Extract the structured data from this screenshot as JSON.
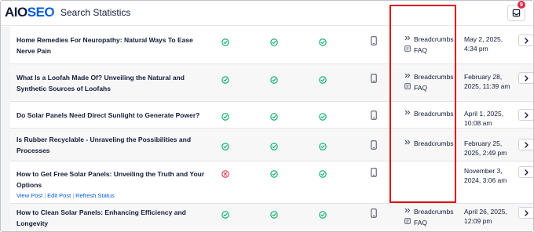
{
  "header": {
    "logo_part1": "AIO",
    "logo_part2": "SEO",
    "separator": "/",
    "title": "Search Statistics",
    "notification_count": "9"
  },
  "colors": {
    "brand_blue": "#005ae0",
    "success_green": "#00aa63",
    "error_red": "#df2a4a",
    "highlight_red": "#e00000",
    "text_dark": "#141b38"
  },
  "rows": [
    {
      "title_lines": [
        "Home Remedies For Neuropathy: Natural Ways To Ease",
        "Nerve Pain"
      ],
      "statuses": [
        "check",
        "check",
        "check"
      ],
      "rich_results": [
        "Breadcrumbs",
        "FAQ"
      ],
      "date_lines": [
        "May 2, 2025,",
        "4:34 pm"
      ]
    },
    {
      "title_lines": [
        "What Is a Loofah Made Of? Unveiling the Natural and",
        "Synthetic Sources of Loofahs"
      ],
      "statuses": [
        "check",
        "check",
        "check"
      ],
      "rich_results": [
        "Breadcrumbs",
        "FAQ"
      ],
      "date_lines": [
        "February 28,",
        "2025, 11:39 am"
      ]
    },
    {
      "title_lines": [
        "Do Solar Panels Need Direct Sunlight to Generate Power?"
      ],
      "statuses": [
        "check",
        "check",
        "check"
      ],
      "rich_results": [
        "Breadcrumbs"
      ],
      "date_lines": [
        "April 1, 2025,",
        "10:08 am"
      ]
    },
    {
      "title_lines": [
        "Is Rubber Recyclable - Unraveling the Possibilities and",
        "Processes"
      ],
      "statuses": [
        "check",
        "check",
        "check"
      ],
      "rich_results": [
        "Breadcrumbs"
      ],
      "date_lines": [
        "February 25,",
        "2025, 2:49 pm"
      ]
    },
    {
      "title_lines": [
        "How to Get Free Solar Panels: Unveiling the Truth and Your",
        "Options"
      ],
      "actions": [
        "View Post",
        "Edit Post",
        "Refresh Status"
      ],
      "action_separator": "|",
      "statuses": [
        "error",
        "check",
        "check"
      ],
      "rich_results": [],
      "date_lines": [
        "November 3,",
        "2024, 3:06 am"
      ]
    },
    {
      "title_lines": [
        "How to Clean Solar Panels: Enhancing Efficiency and",
        "Longevity"
      ],
      "statuses": [
        "check",
        "check",
        "check"
      ],
      "rich_results": [
        "Breadcrumbs",
        "FAQ"
      ],
      "date_lines": [
        "April 26, 2025,",
        "12:09 pm"
      ]
    }
  ],
  "icons": {
    "status_ok": "check-circle-icon",
    "status_error": "x-circle-icon",
    "device": "mobile-phone-icon",
    "breadcrumbs": "double-chevron-icon",
    "faq": "faq-doc-icon",
    "row_expand": "chevron-right-icon",
    "notifications": "inbox-icon"
  }
}
